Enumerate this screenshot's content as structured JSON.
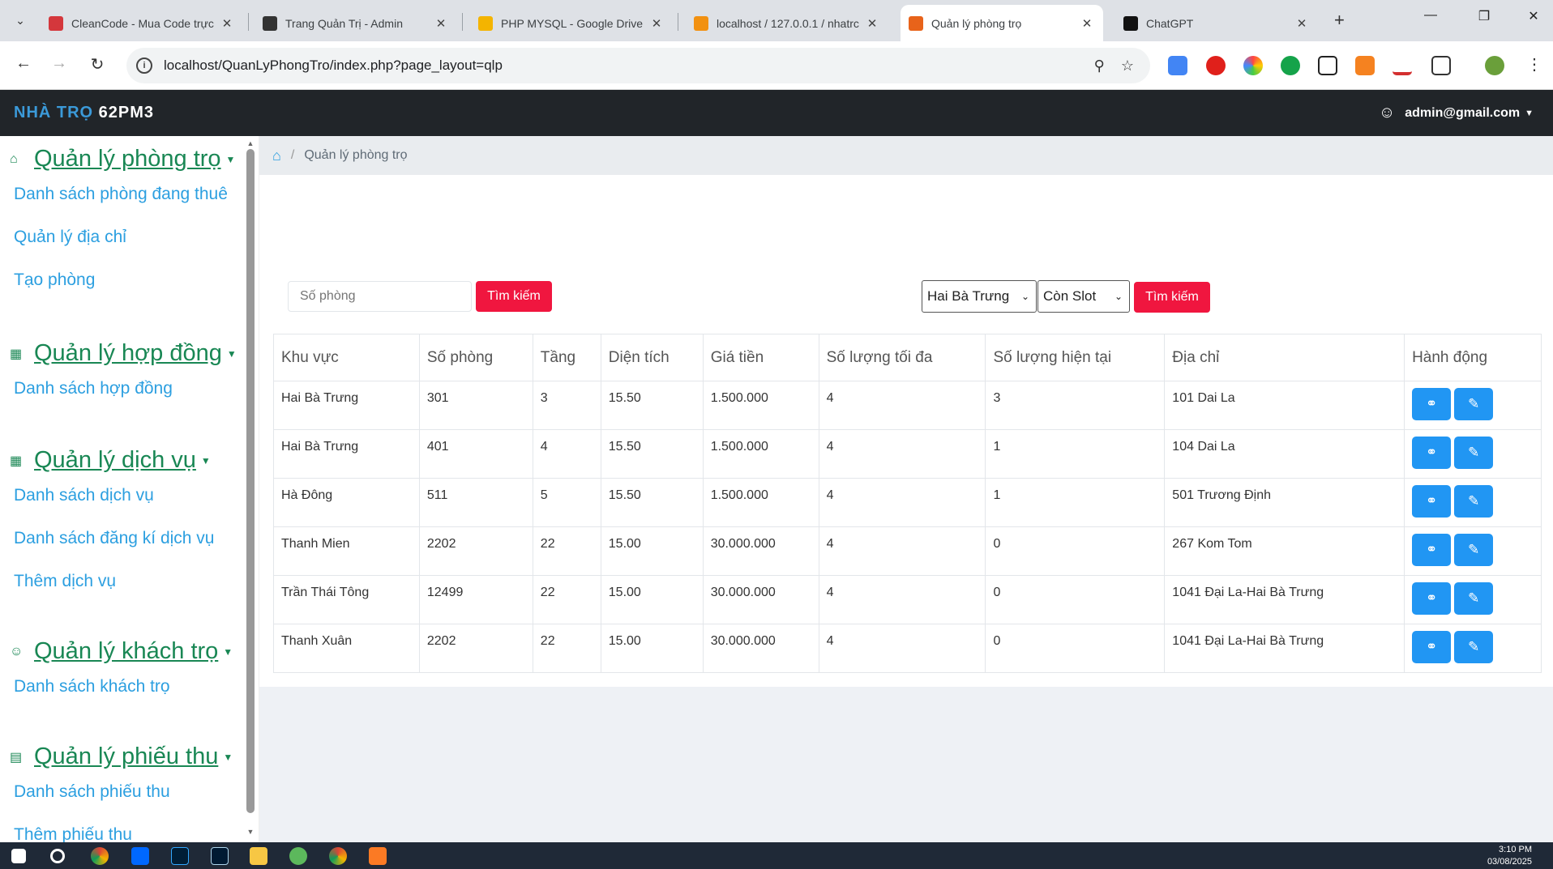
{
  "browser": {
    "tabs": [
      {
        "title": "CleanCode - Mua Code trực",
        "color": "#d4373c"
      },
      {
        "title": "Trang Quản Trị - Admin",
        "color": "#333333"
      },
      {
        "title": "PHP MYSQL - Google Drive",
        "color": "#f4b400"
      },
      {
        "title": "localhost / 127.0.0.1 / nhatrc",
        "color": "#f29111"
      },
      {
        "title": "Quản lý phòng trọ",
        "color": "#e8631a"
      },
      {
        "title": "ChatGPT",
        "color": "#111111"
      }
    ],
    "url": "localhost/QuanLyPhongTro/index.php?page_layout=qlp"
  },
  "header": {
    "brand_part1": "NHÀ TRỌ",
    "brand_part2": "62PM3",
    "user": "admin@gmail.com"
  },
  "sidebar": {
    "sections": [
      {
        "title": "Quản lý phòng trọ",
        "icon": "home-icon",
        "links": [
          "Danh sách phòng đang thuê",
          "Quản lý địa chỉ",
          "Tạo phòng"
        ]
      },
      {
        "title": "Quản lý hợp đồng",
        "icon": "table-icon",
        "links": [
          "Danh sách hợp đồng"
        ]
      },
      {
        "title": "Quản lý dịch vụ",
        "icon": "table-icon",
        "links": [
          "Danh sách dịch vụ",
          "Danh sách đăng kí dịch vụ",
          "Thêm dịch vụ"
        ]
      },
      {
        "title": "Quản lý khách trọ",
        "icon": "person-icon",
        "links": [
          "Danh sách khách trọ"
        ]
      },
      {
        "title": "Quản lý phiếu thu",
        "icon": "receipt-icon",
        "links": [
          "Danh sách phiếu thu",
          "Thêm phiếu thu"
        ]
      }
    ]
  },
  "breadcrumb": {
    "current": "Quản lý phòng trọ"
  },
  "search": {
    "room_placeholder": "Số phòng",
    "search_button": "Tìm kiếm",
    "area_selected": "Hai Bà Trưng",
    "slot_selected": "Còn Slot",
    "filter_button": "Tìm kiếm"
  },
  "table": {
    "headers": [
      "Khu vực",
      "Số phòng",
      "Tầng",
      "Diện tích",
      "Giá tiền",
      "Số lượng tối đa",
      "Số lượng hiện tại",
      "Địa chỉ",
      "Hành động"
    ],
    "rows": [
      [
        "Hai Bà Trưng",
        "301",
        "3",
        "15.50",
        "1.500.000",
        "4",
        "3",
        "101 Dai La"
      ],
      [
        "Hai Bà Trưng",
        "401",
        "4",
        "15.50",
        "1.500.000",
        "4",
        "1",
        "104 Dai La"
      ],
      [
        "Hà Đông",
        "511",
        "5",
        "15.50",
        "1.500.000",
        "4",
        "1",
        "501 Trương Định"
      ],
      [
        "Thanh Mien",
        "2202",
        "22",
        "15.00",
        "30.000.000",
        "4",
        "0",
        "267 Kom Tom"
      ],
      [
        "Trần Thái Tông",
        "12499",
        "22",
        "15.00",
        "30.000.000",
        "4",
        "0",
        "1041 Đại La-Hai Bà Trưng"
      ],
      [
        "Thanh Xuân",
        "2202",
        "22",
        "15.00",
        "30.000.000",
        "4",
        "0",
        "1041 Đại La-Hai Bà Trưng"
      ]
    ]
  },
  "taskbar": {
    "time": "3:10 PM",
    "date": "03/08/2025"
  }
}
